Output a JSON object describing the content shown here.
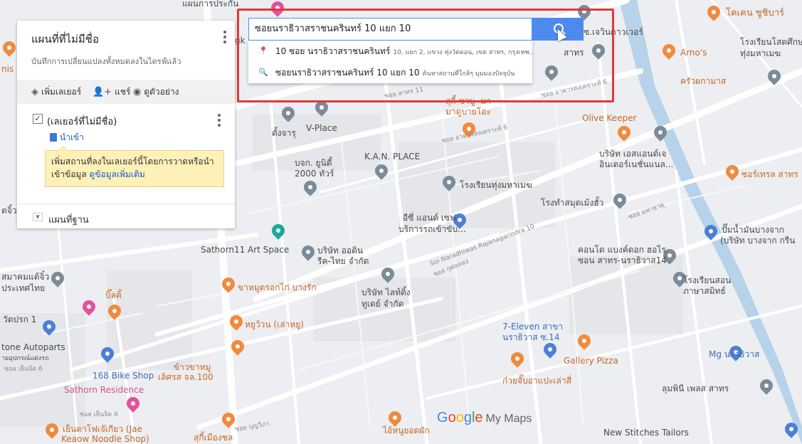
{
  "panel": {
    "title": "แผนที่ที่ไม่มีชื่อ",
    "subtitle": "บันทึกการเปลี่ยนแปลงทั้งหมดลงในไดรฟ์แล้ว",
    "add_layer": "เพิ่มเลเยอร์",
    "share": "แชร์",
    "preview": "ดูตัวอย่าง",
    "layer_title": "(เลเยอร์ที่ไม่มีชื่อ)",
    "import": "นำเข้า",
    "tip_text": "เพิ่มสถานที่ลงในเลเยอร์นี้โดยการวาดหรือนำเข้าข้อมูล",
    "tip_link": "ดูข้อมูลเพิ่มเติม",
    "base_map": "แผนที่ฐาน"
  },
  "search": {
    "value": "ซอยนราธิวาสราชนครินทร์ 10 แยก 10",
    "suggestions": [
      {
        "icon": "place-pin-icon",
        "main": "10 ซอย นราธิวาสราชนครินทร์",
        "secondary": "10, แยก 2, แขวง ทุ่งวัดดอน, เขต สาทร, กรุงเทพ..."
      },
      {
        "icon": "search-icon",
        "main": "ซอยนราธิวาสราชนครินทร์ 10 แยก 10",
        "secondary": "ค้นหาสถานที่ใกล้ๆ มุมมองปัจจุบัน"
      }
    ]
  },
  "map_labels": [
    {
      "text": "แผนการประกัน",
      "color": "dark"
    },
    {
      "text": "ซ.เจวินดาวเวอร์",
      "color": "dark"
    },
    {
      "text": "โคเคน ซูชิบาร์",
      "color": "orange"
    },
    {
      "text": "โรงเรียนโสตศึกษา",
      "color": "dark"
    },
    {
      "text": "ทุ่งมหาเมฆ",
      "color": "dark"
    },
    {
      "text": "Arno's",
      "color": "orange"
    },
    {
      "text": "ครัวผกามาส",
      "color": "orange"
    },
    {
      "text": "สาทร",
      "color": "dark"
    },
    {
      "text": "สุกี้-ซาบู- มา",
      "color": "orange"
    },
    {
      "text": "มาดูบายโอะ",
      "color": "orange"
    },
    {
      "text": "ตั้งจารุ",
      "color": "dark"
    },
    {
      "text": "V-Place",
      "color": "dark"
    },
    {
      "text": "Olive Keeper",
      "color": "orange"
    },
    {
      "text": "บริษัท เอสแอนด์เจ",
      "color": "dark"
    },
    {
      "text": "อินเตอร์เนชั่นแนล...",
      "color": "dark"
    },
    {
      "text": "K.A.N. PLACE",
      "color": "dark"
    },
    {
      "text": "บจก. ยูนิตี้",
      "color": "dark"
    },
    {
      "text": "2000 ทัวร์",
      "color": "dark"
    },
    {
      "text": "โรงเรียนทุ่งมหาเมฆ",
      "color": "dark"
    },
    {
      "text": "ซอร์เทรล สาทร",
      "color": "orange"
    },
    {
      "text": "โรงทำสมุดเม้งฮั้ว",
      "color": "dark"
    },
    {
      "text": "อีซี่ แอนด์ เซฟ",
      "color": "dark"
    },
    {
      "text": "บริการรถเข้าขับ...",
      "color": "dark"
    },
    {
      "text": "ปั๊มน้ำมันบางจาก",
      "color": "dark"
    },
    {
      "text": "(บริษัท บางจาก กรีน",
      "color": "dark"
    },
    {
      "text": "Sathorn11 Art Space",
      "color": "dark"
    },
    {
      "text": "บริษัท ออดิน",
      "color": "dark"
    },
    {
      "text": "รีค-ไทย จำกัด",
      "color": "dark"
    },
    {
      "text": "คอนโด แบงค์ดอก ฮอไร",
      "color": "dark"
    },
    {
      "text": "ซอน สาทร-นราธิวาส14",
      "color": "dark"
    },
    {
      "text": "สมาคมแต้จิ๋ว",
      "color": "dark"
    },
    {
      "text": "ประเทศไทย",
      "color": "dark"
    },
    {
      "text": "ขาหมูตรอกไก่ บางรัก",
      "color": "orange"
    },
    {
      "text": "บริษัท ไลท์ติ้ง",
      "color": "dark"
    },
    {
      "text": "ทูเดย์ จำกัด",
      "color": "dark"
    },
    {
      "text": "โรงเรียนสอน",
      "color": "dark"
    },
    {
      "text": "ภาษาสมิทธ์",
      "color": "dark"
    },
    {
      "text": "บิ๊ลคิ้",
      "color": "orange"
    },
    {
      "text": "วัดปรก 1",
      "color": "dark"
    },
    {
      "text": "หยูว้วน (เล่าหยู)",
      "color": "orange"
    },
    {
      "text": "7-Eleven สาขา",
      "color": "blue"
    },
    {
      "text": "นราธิวาส ซ.14",
      "color": "blue"
    },
    {
      "text": "tone Autoparts",
      "color": "dark"
    },
    {
      "text": "ายอุปกรณ์แต่งรถ",
      "color": "dark"
    },
    {
      "text": "Gallery Pizza",
      "color": "orange"
    },
    {
      "text": "Mg นราธิวาส",
      "color": "blue"
    },
    {
      "text": "ข้าวขาหมู",
      "color": "orange"
    },
    {
      "text": "เลิศรส จล.100",
      "color": "orange"
    },
    {
      "text": "168 Bike Shop",
      "color": "blue"
    },
    {
      "text": "ก๋วยจั๊บอาแปะเล่าสี่",
      "color": "orange"
    },
    {
      "text": "Sathorn Residence",
      "color": "pink"
    },
    {
      "text": "ลุมพินี เพลส สาทร",
      "color": "dark"
    },
    {
      "text": "เย็นตาโฟเจ๊เกียว (Jae",
      "color": "orange"
    },
    {
      "text": "Keaow Noodle Shop)",
      "color": "orange"
    },
    {
      "text": "สุกี้เมืองชล",
      "color": "orange"
    },
    {
      "text": "ไอ้หนูยอดผัก",
      "color": "orange"
    },
    {
      "text": "New Stitches Tailors",
      "color": "dark"
    },
    {
      "text": "ตจิ้ว",
      "color": "dark"
    },
    {
      "text": "nis B",
      "color": "orange"
    },
    {
      "text": "gk",
      "color": "dark"
    }
  ],
  "road_labels": [
    "ซอย อาคารสงเคราะห์ 6",
    "ซอย อาคารสงเคราะห์ 6",
    "Soi Naradhiwas Rajanagarindra 10",
    "ซอย มหาธาตุ",
    "ซอย กุศลทอง",
    "ซอย บุญวิภา",
    "ซอย เย็นจิต 6",
    "ซอย เย็นจิต 6",
    "ซอย สาทร 11"
  ],
  "logo": {
    "google": "Google",
    "my_maps": "My Maps"
  }
}
